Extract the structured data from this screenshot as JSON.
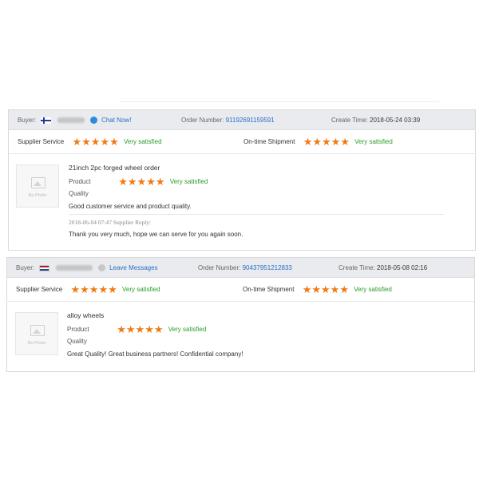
{
  "reviews": [
    {
      "buyer_label": "Buyer:",
      "contact_label": "Chat Now!",
      "order_label": "Order Number:",
      "order_number": "91192691159591",
      "create_label": "Create Time:",
      "create_time": "2018-05-24 03:39",
      "supplier_service_label": "Supplier Service",
      "supplier_service_rating": "Very satisfied",
      "shipment_label": "On-time Shipment",
      "shipment_rating": "Very satisfied",
      "product_title": "21inch 2pc forged wheel order",
      "product_label": "Product",
      "product_rating": "Very satisfied",
      "quality_label": "Quality",
      "comment": "Good customer service and product quality.",
      "reply_meta": "2018-06-04 07:47  Supplier Reply:",
      "reply_text": "Thank you very much, hope we can serve for you again soon.",
      "no_photo": "No Photo"
    },
    {
      "buyer_label": "Buyer:",
      "contact_label": "Leave Messages",
      "order_label": "Order Number:",
      "order_number": "90437951212833",
      "create_label": "Create Time:",
      "create_time": "2018-05-08 02:16",
      "supplier_service_label": "Supplier Service",
      "supplier_service_rating": "Very satisfied",
      "shipment_label": "On-time Shipment",
      "shipment_rating": "Very satisfied",
      "product_title": "alloy wheels",
      "product_label": "Product",
      "product_rating": "Very satisfied",
      "quality_label": "Quality",
      "comment": "Great Quality! Great business partners! Confidential company!",
      "no_photo": "No Photo"
    }
  ],
  "star_glyphs": "★★★★★",
  "colors": {
    "star": "#f07a15",
    "satisfied": "#2a9d2a",
    "link": "#2a6fc9",
    "header_bg": "#e9ebee"
  }
}
